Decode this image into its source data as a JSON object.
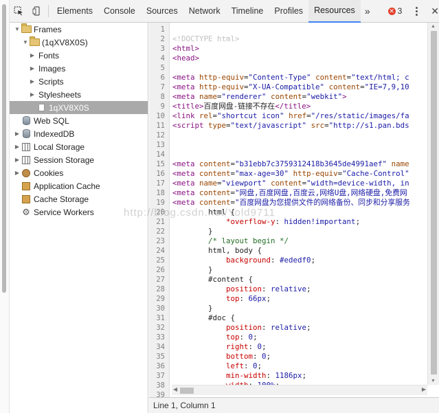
{
  "toolbar": {
    "tabs": [
      "Elements",
      "Console",
      "Sources",
      "Network",
      "Timeline",
      "Profiles",
      "Resources"
    ],
    "active_tab": "Resources",
    "more": "»",
    "error_count": "3",
    "close": "✕"
  },
  "sidebar": {
    "items": [
      {
        "label": "Frames",
        "icon": "folder-icon"
      },
      {
        "label": "(1qXV8X0S)",
        "icon": "folder-icon"
      },
      {
        "label": "Fonts"
      },
      {
        "label": "Images"
      },
      {
        "label": "Scripts"
      },
      {
        "label": "Stylesheets"
      },
      {
        "label": "1qXV8X0S",
        "icon": "document-icon"
      },
      {
        "label": "Web SQL",
        "icon": "database-icon"
      },
      {
        "label": "IndexedDB",
        "icon": "database-icon"
      },
      {
        "label": "Local Storage",
        "icon": "grid-icon"
      },
      {
        "label": "Session Storage",
        "icon": "grid-icon"
      },
      {
        "label": "Cookies",
        "icon": "cookie-icon"
      },
      {
        "label": "Application Cache",
        "icon": "cache-icon"
      },
      {
        "label": "Cache Storage",
        "icon": "cache-icon"
      },
      {
        "label": "Service Workers",
        "icon": "gear-icon"
      }
    ]
  },
  "code": {
    "line_numbers": [
      "1",
      "2",
      "3",
      "4",
      "5",
      "6",
      "7",
      "8",
      "9",
      "10",
      "11",
      "12",
      "13",
      "14",
      "15",
      "16",
      "17",
      "18",
      "19",
      "20",
      "21",
      "22",
      "23",
      "24",
      "25",
      "26",
      "27",
      "28",
      "29",
      "30",
      "31",
      "32",
      "33",
      "34",
      "35",
      "36",
      "37",
      "38",
      "39"
    ],
    "lines": [
      [],
      [
        [
          "doc",
          "<!DOCTYPE html>"
        ]
      ],
      [
        [
          "tag",
          "<html>"
        ]
      ],
      [
        [
          "tag",
          "<head>"
        ]
      ],
      [],
      [
        [
          "tag",
          "<meta "
        ],
        [
          "attr",
          "http-equiv"
        ],
        [
          "txt",
          "="
        ],
        [
          "val",
          "\"Content-Type\" "
        ],
        [
          "attr",
          "content"
        ],
        [
          "txt",
          "="
        ],
        [
          "val",
          "\"text/html; c"
        ]
      ],
      [
        [
          "tag",
          "<meta "
        ],
        [
          "attr",
          "http-equiv"
        ],
        [
          "txt",
          "="
        ],
        [
          "val",
          "\"X-UA-Compatible\" "
        ],
        [
          "attr",
          "content"
        ],
        [
          "txt",
          "="
        ],
        [
          "val",
          "\"IE=7,9,10"
        ]
      ],
      [
        [
          "tag",
          "<meta "
        ],
        [
          "attr",
          "name"
        ],
        [
          "txt",
          "="
        ],
        [
          "val",
          "\"renderer\" "
        ],
        [
          "attr",
          "content"
        ],
        [
          "txt",
          "="
        ],
        [
          "val",
          "\"webkit\""
        ],
        [
          "tag",
          ">"
        ]
      ],
      [
        [
          "tag",
          "<title>"
        ],
        [
          "txt",
          "百度网盘-链接不存在"
        ],
        [
          "tag",
          "</title>"
        ]
      ],
      [
        [
          "tag",
          "<link "
        ],
        [
          "attr",
          "rel"
        ],
        [
          "txt",
          "="
        ],
        [
          "val",
          "\"shortcut icon\" "
        ],
        [
          "attr",
          "href"
        ],
        [
          "txt",
          "="
        ],
        [
          "val",
          "\"/res/static/images/fa"
        ]
      ],
      [
        [
          "tag",
          "<script "
        ],
        [
          "attr",
          "type"
        ],
        [
          "txt",
          "="
        ],
        [
          "val",
          "\"text/javascript\" "
        ],
        [
          "attr",
          "src"
        ],
        [
          "txt",
          "="
        ],
        [
          "val",
          "\"http://s1.pan.bds"
        ]
      ],
      [],
      [],
      [],
      [
        [
          "tag",
          "<meta "
        ],
        [
          "attr",
          "content"
        ],
        [
          "txt",
          "="
        ],
        [
          "val",
          "\"b31ebb7c3759312418b3645de4991aef\" "
        ],
        [
          "attr",
          "name"
        ]
      ],
      [
        [
          "tag",
          "<meta "
        ],
        [
          "attr",
          "content"
        ],
        [
          "txt",
          "="
        ],
        [
          "val",
          "\"max-age=30\" "
        ],
        [
          "attr",
          "http-equiv"
        ],
        [
          "txt",
          "="
        ],
        [
          "val",
          "\"Cache-Control\""
        ]
      ],
      [
        [
          "tag",
          "<meta "
        ],
        [
          "attr",
          "name"
        ],
        [
          "txt",
          "="
        ],
        [
          "val",
          "\"viewport\" "
        ],
        [
          "attr",
          "content"
        ],
        [
          "txt",
          "="
        ],
        [
          "val",
          "\"width=device-width, in"
        ]
      ],
      [
        [
          "tag",
          "<meta "
        ],
        [
          "attr",
          "content"
        ],
        [
          "txt",
          "="
        ],
        [
          "val",
          "\"网盘,百度网盘,百度云,网络U盘,网络硬盘,免费网"
        ]
      ],
      [
        [
          "tag",
          "<meta "
        ],
        [
          "attr",
          "content"
        ],
        [
          "txt",
          "="
        ],
        [
          "val",
          "\"百度网盘为您提供文件的网络备份、同步和分享服务"
        ]
      ],
      [
        [
          "txt",
          "        html {"
        ]
      ],
      [
        [
          "txt",
          "            "
        ],
        [
          "prop",
          "*overflow-y"
        ],
        [
          "txt",
          ": "
        ],
        [
          "val",
          "hidden!important"
        ],
        [
          "txt",
          ";"
        ]
      ],
      [
        [
          "txt",
          "        }"
        ]
      ],
      [
        [
          "txt",
          "        "
        ],
        [
          "cmt",
          "/* layout begin */"
        ]
      ],
      [
        [
          "txt",
          "        html, body {"
        ]
      ],
      [
        [
          "txt",
          "            "
        ],
        [
          "prop",
          "background"
        ],
        [
          "txt",
          ": "
        ],
        [
          "val",
          "#ededf0"
        ],
        [
          "txt",
          ";"
        ]
      ],
      [
        [
          "txt",
          "        }"
        ]
      ],
      [
        [
          "txt",
          "        #content {"
        ]
      ],
      [
        [
          "txt",
          "            "
        ],
        [
          "prop",
          "position"
        ],
        [
          "txt",
          ": "
        ],
        [
          "val",
          "relative"
        ],
        [
          "txt",
          ";"
        ]
      ],
      [
        [
          "txt",
          "            "
        ],
        [
          "prop",
          "top"
        ],
        [
          "txt",
          ": "
        ],
        [
          "val",
          "66px"
        ],
        [
          "txt",
          ";"
        ]
      ],
      [
        [
          "txt",
          "        }"
        ]
      ],
      [
        [
          "txt",
          "        #doc {"
        ]
      ],
      [
        [
          "txt",
          "            "
        ],
        [
          "prop",
          "position"
        ],
        [
          "txt",
          ": "
        ],
        [
          "val",
          "relative"
        ],
        [
          "txt",
          ";"
        ]
      ],
      [
        [
          "txt",
          "            "
        ],
        [
          "prop",
          "top"
        ],
        [
          "txt",
          ": "
        ],
        [
          "val",
          "0"
        ],
        [
          "txt",
          ";"
        ]
      ],
      [
        [
          "txt",
          "            "
        ],
        [
          "prop",
          "right"
        ],
        [
          "txt",
          ": "
        ],
        [
          "val",
          "0"
        ],
        [
          "txt",
          ";"
        ]
      ],
      [
        [
          "txt",
          "            "
        ],
        [
          "prop",
          "bottom"
        ],
        [
          "txt",
          ": "
        ],
        [
          "val",
          "0"
        ],
        [
          "txt",
          ";"
        ]
      ],
      [
        [
          "txt",
          "            "
        ],
        [
          "prop",
          "left"
        ],
        [
          "txt",
          ": "
        ],
        [
          "val",
          "0"
        ],
        [
          "txt",
          ";"
        ]
      ],
      [
        [
          "txt",
          "            "
        ],
        [
          "prop",
          "min-width"
        ],
        [
          "txt",
          ": "
        ],
        [
          "val",
          "1186px"
        ],
        [
          "txt",
          ";"
        ]
      ],
      [
        [
          "txt",
          "            "
        ],
        [
          "prop",
          "width"
        ],
        [
          "txt",
          ": "
        ],
        [
          "val",
          "100%"
        ],
        [
          "txt",
          ";"
        ]
      ],
      []
    ]
  },
  "status": {
    "cursor": "Line 1, Column 1"
  },
  "watermark": "http://blog.csdn.net/Yold9711"
}
